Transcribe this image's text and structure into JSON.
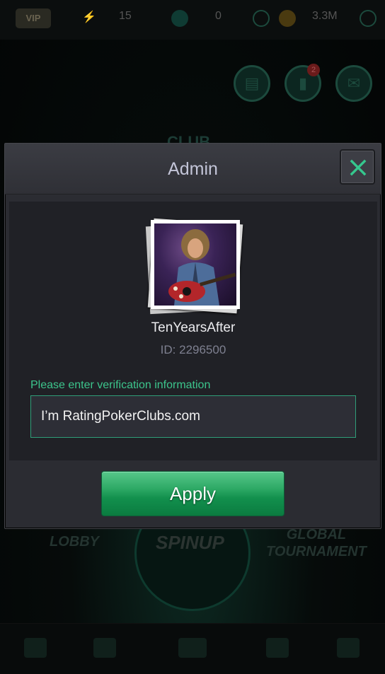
{
  "status_bar": {
    "vip_label": "VIP",
    "energy_count": "15",
    "gem_count": "0",
    "coin_balance": "3.3M"
  },
  "background": {
    "club_label": "CLUB",
    "lobby_label": "LOBBY",
    "spinup_label": "SPINUP",
    "global_tournament_label": "GLOBAL\nTOURNAMENT",
    "notification_badge": "2"
  },
  "modal": {
    "title": "Admin",
    "close_icon": "close-icon",
    "username": "TenYearsAfter",
    "user_id": "ID: 2296500",
    "field_label": "Please enter verification information",
    "field_value": "I’m RatingPokerClubs.com",
    "apply_label": "Apply"
  },
  "colors": {
    "accent_green": "#3cc58c",
    "button_green": "#12904d",
    "modal_bg": "#2b2c32",
    "panel_bg": "#202126"
  }
}
